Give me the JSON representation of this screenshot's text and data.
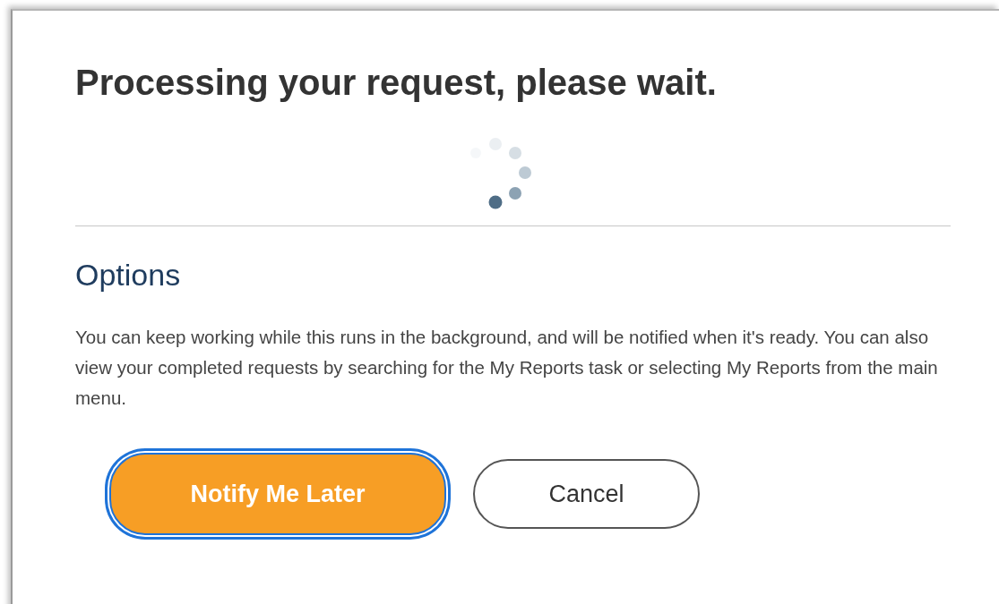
{
  "dialog": {
    "title": "Processing your request, please wait.",
    "options_heading": "Options",
    "message": "You can keep working while this runs in the background, and will be notified when it's ready. You can also view your completed requests by searching for the My Reports task or selecting My Reports from the main menu.",
    "buttons": [
      {
        "label": "Notify Me Later",
        "kind": "primary",
        "focused": true
      },
      {
        "label": "Cancel",
        "kind": "secondary",
        "focused": false
      }
    ]
  }
}
